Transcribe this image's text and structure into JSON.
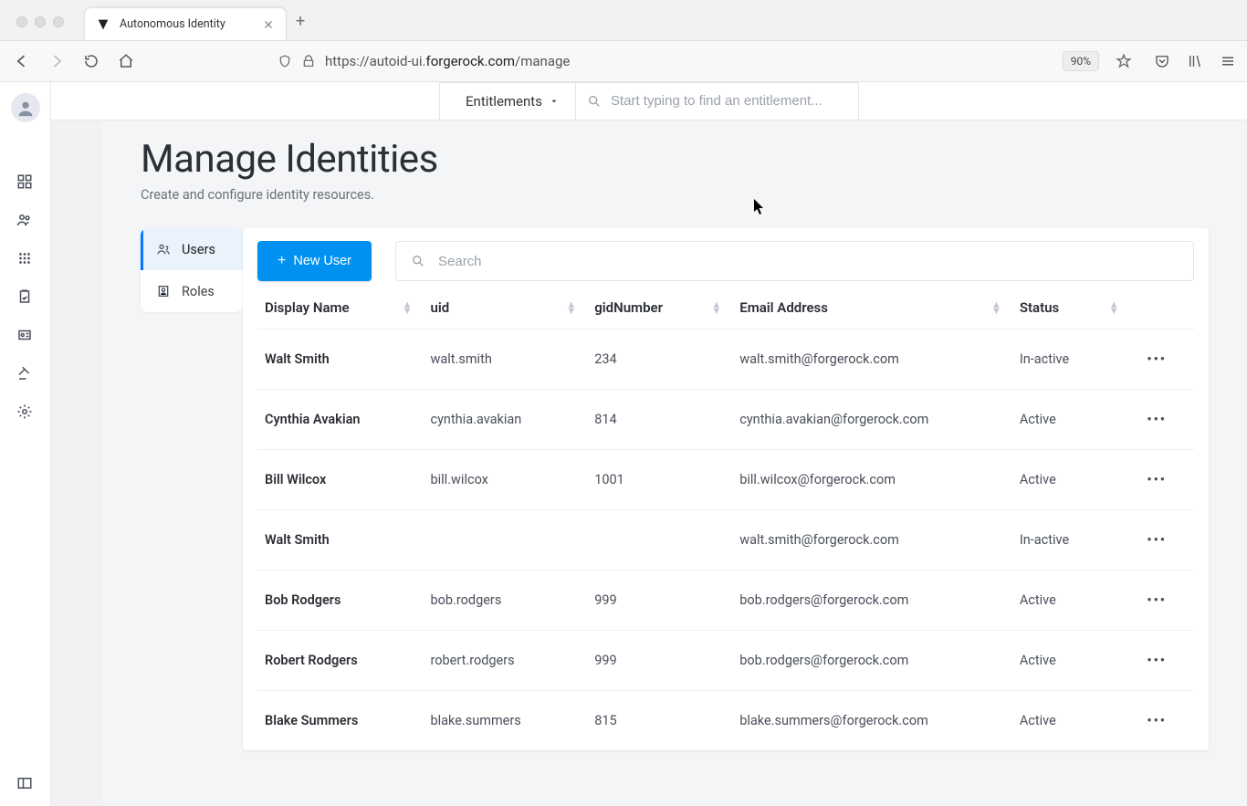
{
  "browser": {
    "tab_title": "Autonomous Identity",
    "url_prefix": "https://autoid-ui.",
    "url_domain": "forgerock.com",
    "url_path": "/manage",
    "zoom": "90%"
  },
  "header": {
    "dropdown_label": "Entitlements",
    "search_placeholder": "Start typing to find an entitlement..."
  },
  "page": {
    "title": "Manage Identities",
    "subtitle": "Create and configure identity resources."
  },
  "side_tabs": {
    "users": "Users",
    "roles": "Roles"
  },
  "actions": {
    "new_user": "New User",
    "table_search_placeholder": "Search"
  },
  "table": {
    "columns": {
      "display_name": "Display Name",
      "uid": "uid",
      "gid": "gidNumber",
      "email": "Email Address",
      "status": "Status"
    },
    "rows": [
      {
        "display_name": "Walt Smith",
        "uid": "walt.smith",
        "gid": "234",
        "email": "walt.smith@forgerock.com",
        "status": "In-active"
      },
      {
        "display_name": "Cynthia Avakian",
        "uid": "cynthia.avakian",
        "gid": "814",
        "email": "cynthia.avakian@forgerock.com",
        "status": "Active"
      },
      {
        "display_name": "Bill Wilcox",
        "uid": "bill.wilcox",
        "gid": "1001",
        "email": "bill.wilcox@forgerock.com",
        "status": "Active"
      },
      {
        "display_name": "Walt Smith",
        "uid": "",
        "gid": "",
        "email": "walt.smith@forgerock.com",
        "status": "In-active"
      },
      {
        "display_name": "Bob Rodgers",
        "uid": "bob.rodgers",
        "gid": "999",
        "email": "bob.rodgers@forgerock.com",
        "status": "Active"
      },
      {
        "display_name": "Robert Rodgers",
        "uid": "robert.rodgers",
        "gid": "999",
        "email": "bob.rodgers@forgerock.com",
        "status": "Active"
      },
      {
        "display_name": "Blake Summers",
        "uid": "blake.summers",
        "gid": "815",
        "email": "blake.summers@forgerock.com",
        "status": "Active"
      }
    ]
  }
}
